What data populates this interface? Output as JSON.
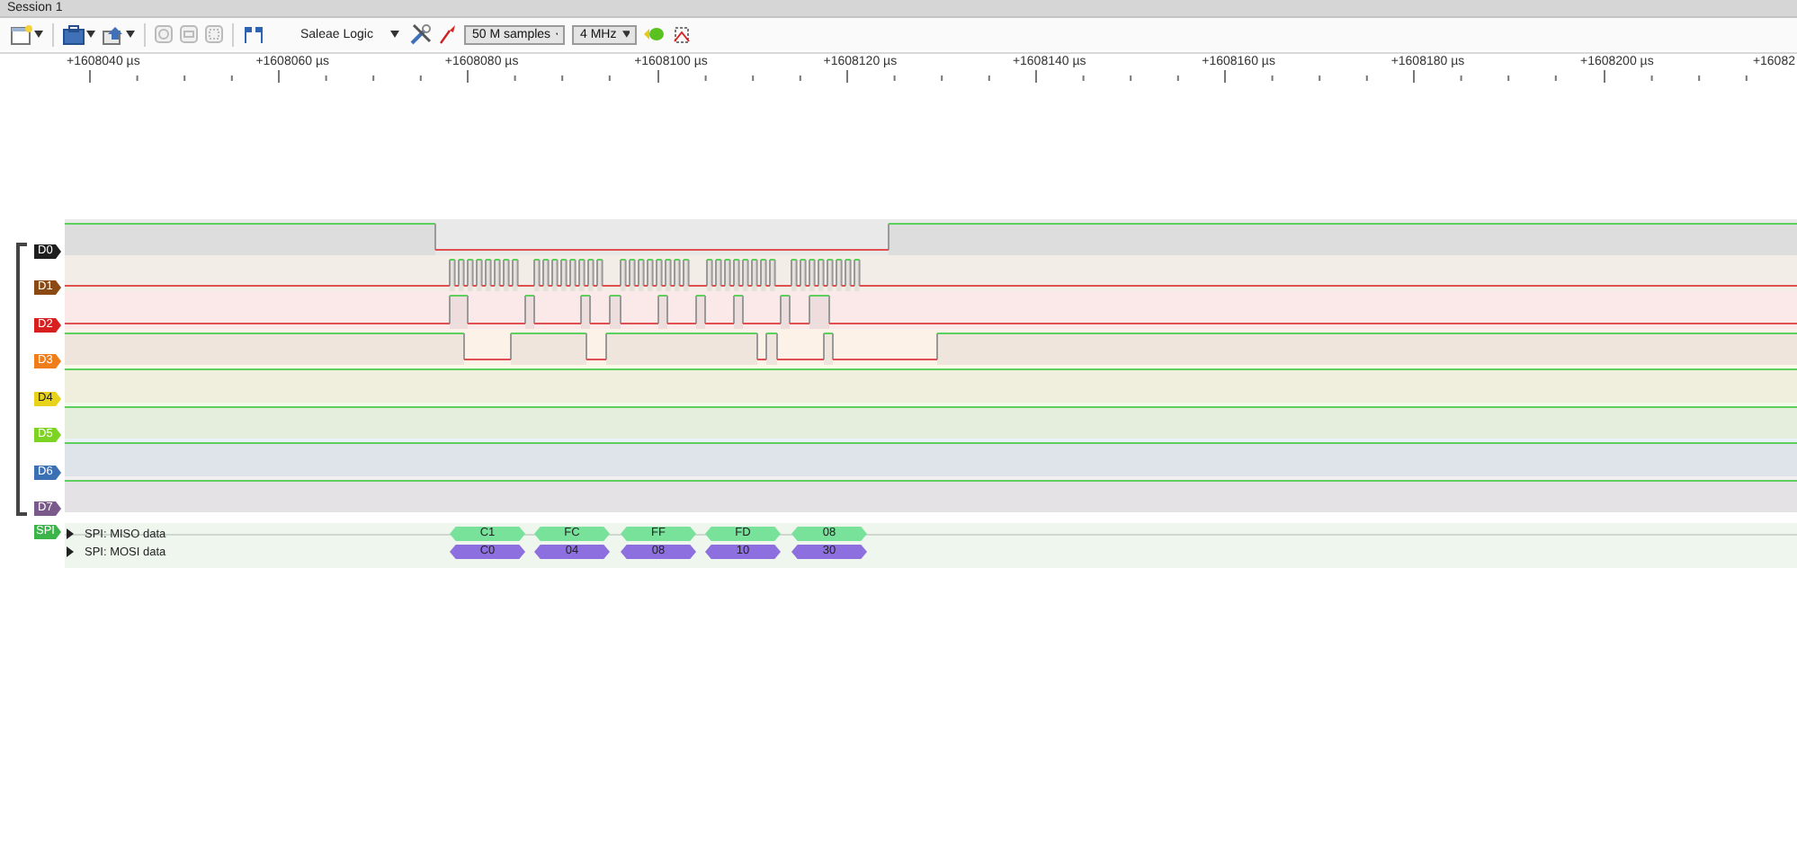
{
  "window": {
    "title": "Session 1"
  },
  "toolbar": {
    "device": "Saleae Logic",
    "sample_count": "50 M samples",
    "sample_rate": "4 MHz"
  },
  "ruler": {
    "labels": [
      "+1608040 µs",
      "+1608060 µs",
      "+1608080 µs",
      "+1608100 µs",
      "+1608120 µs",
      "+1608140 µs",
      "+1608160 µs",
      "+1608180 µs",
      "+1608200 µs",
      "+16082"
    ]
  },
  "channels": [
    {
      "label": "D0",
      "color": "#1e1e1e"
    },
    {
      "label": "D1",
      "color": "#8b4a13"
    },
    {
      "label": "D2",
      "color": "#d81f1f"
    },
    {
      "label": "D3",
      "color": "#ef7d1a"
    },
    {
      "label": "D4",
      "color": "#e8d21a"
    },
    {
      "label": "D5",
      "color": "#7dd321"
    },
    {
      "label": "D6",
      "color": "#3b70b5"
    },
    {
      "label": "D7",
      "color": "#7a5a8a"
    }
  ],
  "analyzer": {
    "label": "SPI",
    "rows": [
      {
        "name": "SPI: MISO data",
        "kind": "miso",
        "frames": [
          "C1",
          "FC",
          "FF",
          "FD",
          "08"
        ]
      },
      {
        "name": "SPI: MOSI data",
        "kind": "mosi",
        "frames": [
          "C0",
          "04",
          "08",
          "10",
          "30"
        ]
      }
    ]
  }
}
